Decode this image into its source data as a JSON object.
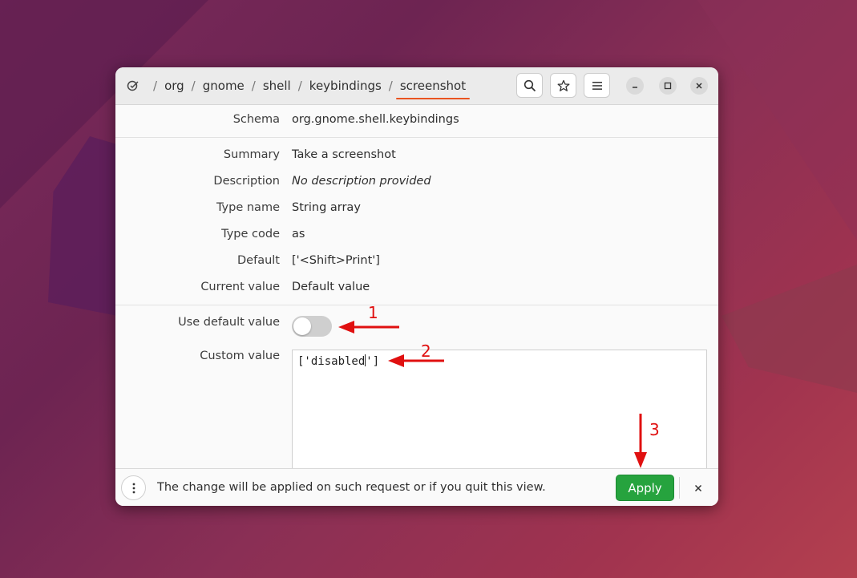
{
  "breadcrumb": {
    "items": [
      "org",
      "gnome",
      "shell",
      "keybindings",
      "screenshot"
    ],
    "separator": "/"
  },
  "header": {
    "search_icon": "search-icon",
    "bookmark_icon": "star-icon",
    "menu_icon": "hamburger-menu-icon"
  },
  "details": {
    "schema": {
      "label": "Schema",
      "value": "org.gnome.shell.keybindings"
    },
    "summary": {
      "label": "Summary",
      "value": "Take a screenshot"
    },
    "description": {
      "label": "Description",
      "value": "No description provided"
    },
    "type_name": {
      "label": "Type name",
      "value": "String array"
    },
    "type_code": {
      "label": "Type code",
      "value": "as"
    },
    "default": {
      "label": "Default",
      "value": "['<Shift>Print']"
    },
    "current_value": {
      "label": "Current value",
      "value": "Default value"
    }
  },
  "settings": {
    "use_default_label": "Use default value",
    "use_default_on": false,
    "custom_value_label": "Custom value",
    "custom_value_before_caret": "['disabled",
    "custom_value_after_caret": "']"
  },
  "infobar": {
    "message": "The change will be applied on such request or if you quit this view.",
    "apply_label": "Apply"
  },
  "annotations": [
    "1",
    "2",
    "3"
  ],
  "colors": {
    "accent_underline": "#e95420",
    "apply_button": "#26a33e",
    "annotation": "#e01010"
  }
}
